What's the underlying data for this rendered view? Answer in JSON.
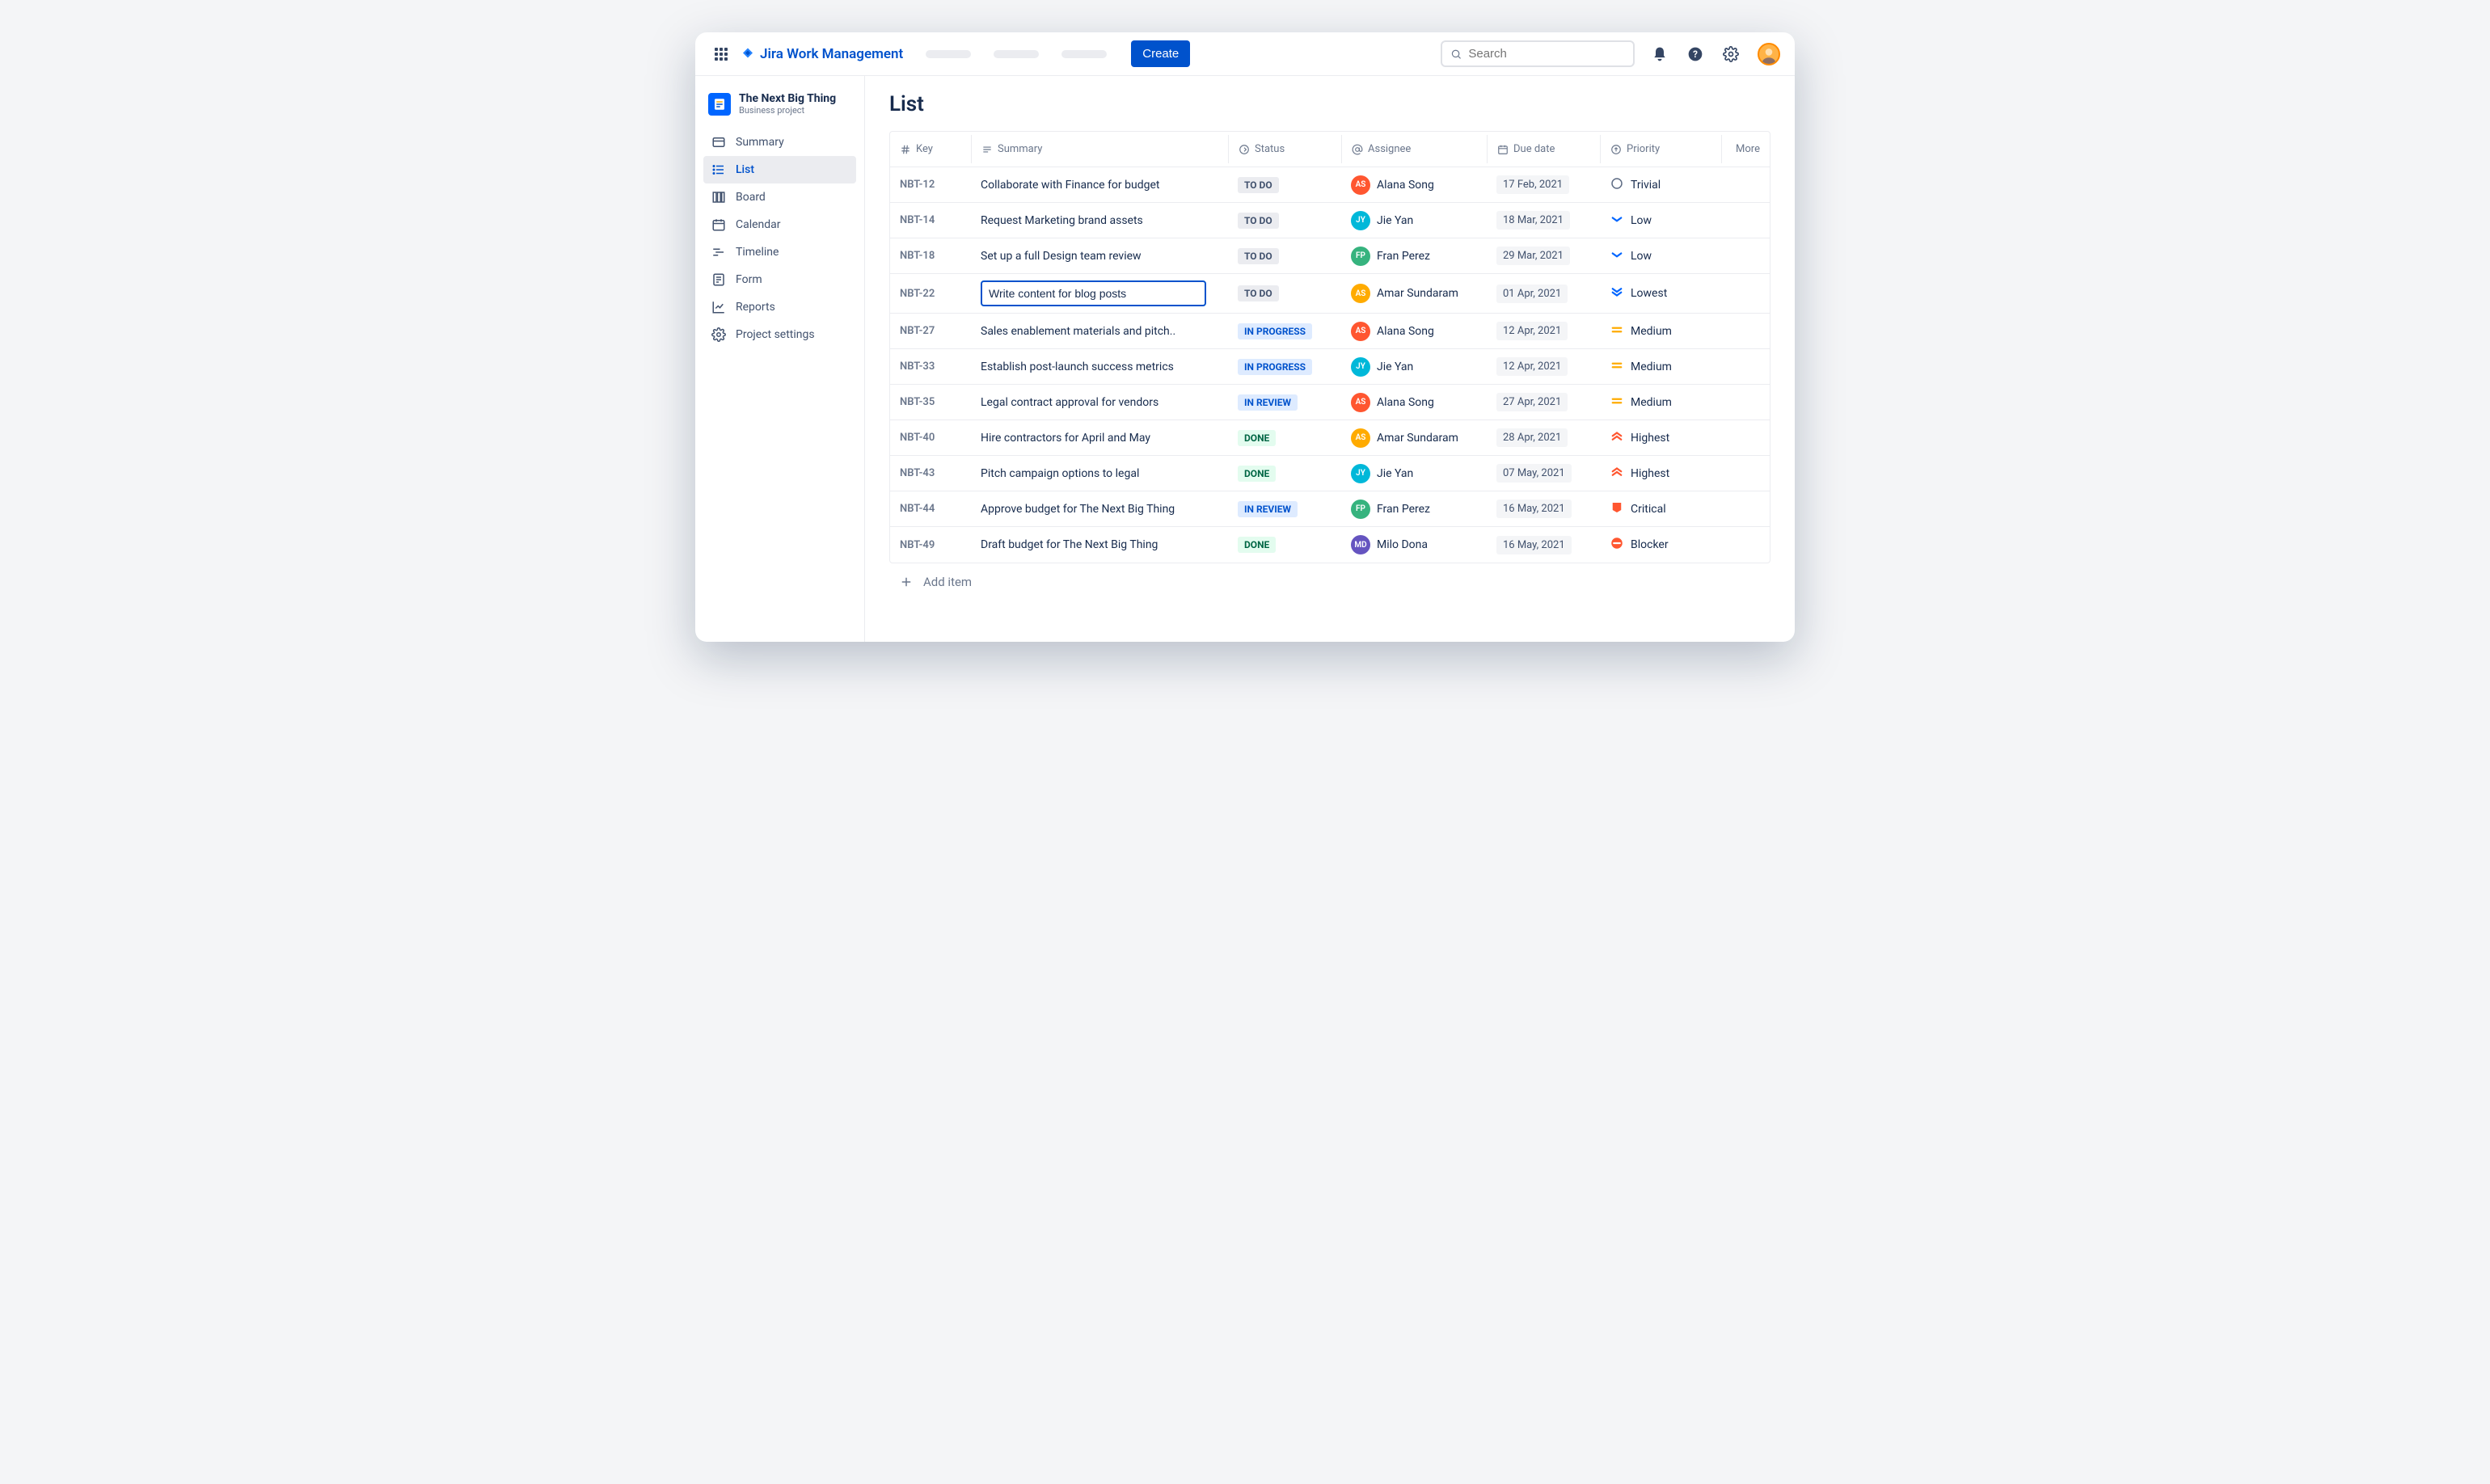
{
  "header": {
    "product_name": "Jira Work Management",
    "create_label": "Create",
    "search_placeholder": "Search"
  },
  "project": {
    "name": "The Next Big Thing",
    "subtitle": "Business project"
  },
  "sidebar": {
    "items": [
      {
        "label": "Summary",
        "icon": "summary"
      },
      {
        "label": "List",
        "icon": "list",
        "active": true
      },
      {
        "label": "Board",
        "icon": "board"
      },
      {
        "label": "Calendar",
        "icon": "calendar"
      },
      {
        "label": "Timeline",
        "icon": "timeline"
      },
      {
        "label": "Form",
        "icon": "form"
      },
      {
        "label": "Reports",
        "icon": "reports"
      },
      {
        "label": "Project settings",
        "icon": "settings"
      }
    ]
  },
  "page": {
    "title": "List",
    "add_item_label": "Add item"
  },
  "columns": {
    "key": "Key",
    "summary": "Summary",
    "status": "Status",
    "assignee": "Assignee",
    "due": "Due date",
    "priority": "Priority",
    "more": "More"
  },
  "status_labels": {
    "todo": "TO DO",
    "inprogress": "IN PROGRESS",
    "inreview": "IN REVIEW",
    "done": "DONE"
  },
  "priorities": {
    "trivial": "Trivial",
    "low": "Low",
    "lowest": "Lowest",
    "medium": "Medium",
    "highest": "Highest",
    "critical": "Critical",
    "blocker": "Blocker"
  },
  "avatar_colors": {
    "Alana Song": "#FF5630",
    "Jie Yan": "#00B8D9",
    "Fran Perez": "#36B37E",
    "Amar Sundaram": "#FFAB00",
    "Milo Dona": "#6554C0"
  },
  "rows": [
    {
      "key": "NBT-12",
      "summary": "Collaborate with Finance for budget",
      "status": "todo",
      "assignee": "Alana Song",
      "due": "17 Feb, 2021",
      "priority": "trivial"
    },
    {
      "key": "NBT-14",
      "summary": "Request Marketing brand assets",
      "status": "todo",
      "assignee": "Jie Yan",
      "due": "18 Mar, 2021",
      "priority": "low"
    },
    {
      "key": "NBT-18",
      "summary": "Set up a full Design team review",
      "status": "todo",
      "assignee": "Fran Perez",
      "due": "29 Mar, 2021",
      "priority": "low"
    },
    {
      "key": "NBT-22",
      "summary": "Write content for blog posts",
      "status": "todo",
      "assignee": "Amar Sundaram",
      "due": "01 Apr, 2021",
      "priority": "lowest",
      "editing": true
    },
    {
      "key": "NBT-27",
      "summary": "Sales enablement materials and pitch..",
      "status": "inprogress",
      "assignee": "Alana Song",
      "due": "12 Apr, 2021",
      "priority": "medium"
    },
    {
      "key": "NBT-33",
      "summary": "Establish post-launch success metrics",
      "status": "inprogress",
      "assignee": "Jie Yan",
      "due": "12 Apr, 2021",
      "priority": "medium"
    },
    {
      "key": "NBT-35",
      "summary": "Legal contract approval for vendors",
      "status": "inreview",
      "assignee": "Alana Song",
      "due": "27 Apr, 2021",
      "priority": "medium"
    },
    {
      "key": "NBT-40",
      "summary": "Hire contractors for April and May",
      "status": "done",
      "assignee": "Amar Sundaram",
      "due": "28 Apr, 2021",
      "priority": "highest"
    },
    {
      "key": "NBT-43",
      "summary": "Pitch campaign options to legal",
      "status": "done",
      "assignee": "Jie Yan",
      "due": "07 May, 2021",
      "priority": "highest"
    },
    {
      "key": "NBT-44",
      "summary": "Approve budget for The Next Big Thing",
      "status": "inreview",
      "assignee": "Fran Perez",
      "due": "16 May, 2021",
      "priority": "critical"
    },
    {
      "key": "NBT-49",
      "summary": "Draft budget for The Next Big Thing",
      "status": "done",
      "assignee": "Milo Dona",
      "due": "16 May, 2021",
      "priority": "blocker"
    }
  ]
}
